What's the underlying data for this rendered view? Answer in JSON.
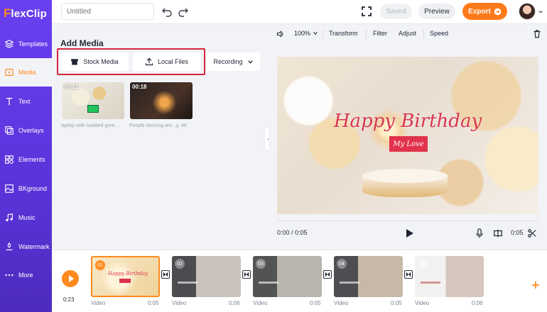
{
  "app": {
    "logo_first": "F",
    "logo_rest": "lexClip"
  },
  "sidebar": {
    "items": [
      {
        "label": "Templates",
        "icon": "layers-icon"
      },
      {
        "label": "Media",
        "icon": "media-icon",
        "active": true
      },
      {
        "label": "Text",
        "icon": "text-icon"
      },
      {
        "label": "Overlays",
        "icon": "overlays-icon"
      },
      {
        "label": "Elements",
        "icon": "elements-icon"
      },
      {
        "label": "BKground",
        "icon": "background-icon"
      },
      {
        "label": "Music",
        "icon": "music-icon"
      },
      {
        "label": "Watermark",
        "icon": "watermark-icon"
      },
      {
        "label": "More",
        "icon": "more-icon"
      }
    ]
  },
  "topbar": {
    "title_placeholder": "Untitled",
    "saved_label": "Saved",
    "preview_label": "Preview",
    "export_label": "Export"
  },
  "media": {
    "title": "Add Media",
    "stock_label": "Stock Media",
    "local_label": "Local Files",
    "recording_label": "Recording",
    "items": [
      {
        "duration": "00:21",
        "caption": "laptop with isolated gree..."
      },
      {
        "duration": "00:18",
        "caption": "People dancing aro...y. 4K"
      }
    ]
  },
  "preview": {
    "zoom": "100%",
    "tools": [
      "Transform",
      "Filter",
      "Adjust",
      "Speed"
    ],
    "headline": "Happy Birthday",
    "name_tag": "My Love",
    "current_time": "0:00 / 0:05",
    "end_time": "0:05"
  },
  "timeline": {
    "time": "0:23",
    "clips": [
      {
        "num": "01",
        "label": "Video",
        "duration": "0:05"
      },
      {
        "num": "02",
        "label": "Video",
        "duration": "0:06"
      },
      {
        "num": "03",
        "label": "Video",
        "duration": "0:05"
      },
      {
        "num": "04",
        "label": "Video",
        "duration": "0:05"
      },
      {
        "num": "05",
        "label": "Video",
        "duration": "0:06"
      }
    ],
    "clip1_title": "Happy Birthday"
  },
  "colors": {
    "accent": "#ff7a1a",
    "sidebar": "#5b33d9",
    "highlight": "#d7263d"
  }
}
